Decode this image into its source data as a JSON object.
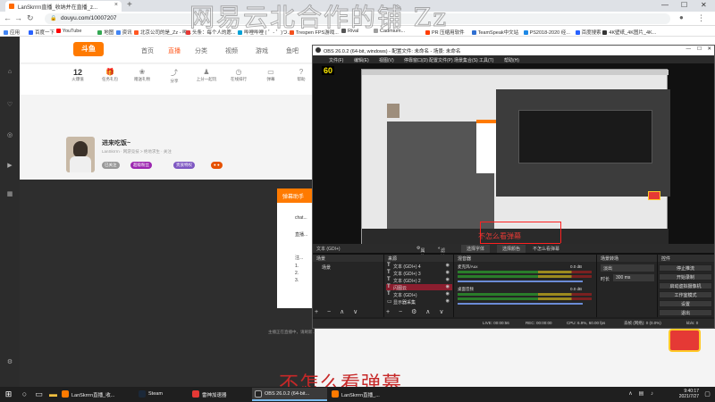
{
  "browser": {
    "tab_title": "LanSkrrrn直播_收纳并在直播_z...",
    "url": "douyu.com/10007207",
    "bookmarks": [
      "应用",
      "百度一下",
      "YouTube",
      "地图",
      "资讯",
      "北京公司的是_Zz - 哔...",
      "头条：每个人的愿...",
      "哔哩哔哩 ( ゜- ゜)つ...",
      "Trespen FPS游戏...",
      "Rival",
      "Cadmium...",
      "PR 压缩用软件",
      "TeamSpeak中文站",
      "PS2018-2020 经...",
      "百度搜索",
      "4K壁纸_4K图片_4K..."
    ]
  },
  "watermark": "网易云北合作的铺 Zz",
  "douyu": {
    "logo": "斗鱼",
    "nav": [
      "首页",
      "直播",
      "分类",
      "视频",
      "游戏",
      "鱼吧"
    ],
    "tools": [
      {
        "icon": "count",
        "value": "12",
        "label": "火爆值"
      },
      {
        "icon": "badge",
        "value": "3",
        "label": "任务礼包"
      },
      {
        "icon": "gift-icon",
        "label": "赠送礼物"
      },
      {
        "icon": "share-icon",
        "label": "分享"
      },
      {
        "icon": "game-icon",
        "label": "上分一起玩"
      },
      {
        "icon": "clock-icon",
        "label": "在线排行"
      },
      {
        "icon": "chat-icon",
        "label": "弹幕"
      },
      {
        "icon": "help-icon",
        "label": "帮助"
      }
    ],
    "room_title": "进来吃饭~",
    "room_sub": "LanSkrrrn · 网游竞技 > 绝地求生 · 关注",
    "badges": [
      "已关注",
      "超级粉丝",
      "贵族特权"
    ],
    "dialog_head": "弹幕助手",
    "dialog_lines": [
      "chat...",
      "直播...",
      "注...",
      "1.",
      "2.",
      "3."
    ],
    "bottom_note": "主播正在直播中，请刷新..."
  },
  "obs": {
    "title": "OBS 26.0.2 (64-bit, windows) - 配置文件: 未命名 - 场景: 未命名",
    "menu": [
      "文件(F)",
      "编辑(E)",
      "视图(V)",
      "停靠窗口(D)",
      "配置文件(P)",
      "场景集合(S)",
      "工具(T)",
      "帮助(H)"
    ],
    "fps": "60",
    "preview_caption": "不怎么看弹幕",
    "source_bar": {
      "label": "文本 (GDI+)",
      "props": "属性",
      "filters": "滤镜",
      "select": "选择字体",
      "font": "选择颜色",
      "text": "不怎么看弹幕"
    },
    "docks": {
      "scenes": "场景",
      "sources": "来源",
      "mixer": "混音器",
      "transitions": "场景转场",
      "controls": "控件"
    },
    "scene_item": "场景",
    "sources": [
      "文本 (GDI+) 4",
      "文本 (GDI+) 3",
      "文本 (GDI+) 2",
      "闪图云",
      "文本 (GDI+)",
      "显示器采集"
    ],
    "mixer": [
      {
        "name": "麦克风/Aux",
        "db": "0.0 dB"
      },
      {
        "name": "桌面音频",
        "db": "0.0 dB"
      }
    ],
    "transition": "淡出",
    "duration_label": "时长",
    "duration": "300 ms",
    "controls": [
      "停止推流",
      "开始录制",
      "启动虚拟摄像机",
      "工作室模式",
      "设置",
      "退出"
    ],
    "status": {
      "live": "LIVE: 00:00:56",
      "rec": "REC: 00:00:00",
      "cpu": "CPU: 6.9%, 60.00 fps",
      "dropped": "丢帧 (网络): 0 (0.0%)",
      "kbps": "kb/s: 0"
    }
  },
  "bottom_caption": "不怎么看弹幕",
  "taskbar": {
    "apps": [
      "LanSkrrrn直播_收...",
      "Steam",
      "雷神加速器",
      "OBS 26.0.2 (64-bit...",
      "LanSkrrrn直播_..."
    ],
    "time": "9:40:17",
    "date": "2021/7/27"
  }
}
